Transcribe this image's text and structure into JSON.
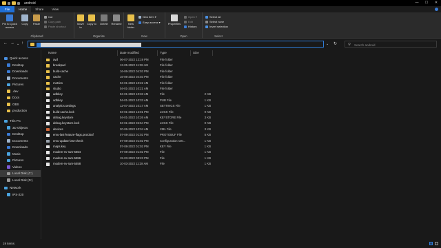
{
  "window": {
    "title": "android",
    "controls": [
      "—",
      "☐",
      "✕"
    ]
  },
  "ribbon_tabs": [
    "File",
    "Home",
    "Share",
    "View"
  ],
  "ribbon": {
    "clipboard": {
      "name": "Clipboard",
      "pin": "Pin to Quick access",
      "copy": "Copy",
      "paste": "Paste",
      "cut": "Cut",
      "copy_path": "Copy path",
      "paste_shortcut": "Paste shortcut"
    },
    "organize": {
      "name": "Organize",
      "move_to": "Move to",
      "copy_to": "Copy to",
      "delete": "Delete",
      "rename": "Rename"
    },
    "new": {
      "name": "New",
      "new_folder": "New folder",
      "new_item": "New item ▾",
      "easy_access": "Easy access ▾"
    },
    "open": {
      "name": "Open",
      "properties": "Properties",
      "open": "Open ▾",
      "edit": "Edit",
      "history": "History"
    },
    "select": {
      "name": "Select",
      "select_all": "Select all",
      "select_none": "Select none",
      "invert": "Invert selection"
    }
  },
  "address": {
    "search_placeholder": "Search android"
  },
  "sidebar": {
    "items": [
      {
        "label": "Quick access",
        "icon": "star-icon",
        "color": "#4a90e2"
      },
      {
        "label": "Desktop",
        "icon": "desktop-icon",
        "color": "#3a7bd5"
      },
      {
        "label": "Downloads",
        "icon": "downloads-icon",
        "color": "#3a7bd5"
      },
      {
        "label": "Documents",
        "icon": "documents-icon",
        "color": "#9fb4cc"
      },
      {
        "label": "Pictures",
        "icon": "pictures-icon",
        "color": "#4aa3df"
      },
      {
        "label": ".dev",
        "icon": "folder-icon",
        "color": "#e8c04a"
      },
      {
        "label": "Docs",
        "icon": "folder-icon",
        "color": "#e8c04a"
      },
      {
        "label": "OBS",
        "icon": "folder-icon",
        "color": "#e8c04a"
      },
      {
        "label": "production",
        "icon": "folder-icon",
        "color": "#e8c04a"
      },
      {
        "label": "This PC",
        "icon": "computer-icon",
        "color": "#4aa3df"
      },
      {
        "label": "3D Objects",
        "icon": "3d-objects-icon",
        "color": "#4aa3df"
      },
      {
        "label": "Desktop",
        "icon": "desktop-icon",
        "color": "#3a7bd5"
      },
      {
        "label": "Documents",
        "icon": "documents-icon",
        "color": "#9fb4cc"
      },
      {
        "label": "Downloads",
        "icon": "downloads-icon",
        "color": "#3a7bd5"
      },
      {
        "label": "Music",
        "icon": "music-icon",
        "color": "#4aa3df"
      },
      {
        "label": "Pictures",
        "icon": "pictures-icon",
        "color": "#4aa3df"
      },
      {
        "label": "Videos",
        "icon": "videos-icon",
        "color": "#7b5ad6"
      },
      {
        "label": "Local Disk (C:)",
        "icon": "drive-icon",
        "color": "#9a9a9a"
      },
      {
        "label": "Local Disk (D:)",
        "icon": "drive-icon",
        "color": "#9a9a9a"
      },
      {
        "label": "Network",
        "icon": "network-icon",
        "color": "#4aa3df"
      },
      {
        "label": "IPS-220",
        "icon": "computer-icon",
        "color": "#4aa3df"
      }
    ]
  },
  "columns": {
    "name": "Name",
    "date": "Date modified",
    "type": "Type",
    "size": "Size"
  },
  "files": [
    {
      "name": "avd",
      "date": "06-07-2022 12:19 PM",
      "type": "File folder",
      "size": "",
      "kind": "folder"
    },
    {
      "name": "breakpad",
      "date": "13-05-2022 11:38 AM",
      "type": "File folder",
      "size": "",
      "kind": "folder"
    },
    {
      "name": "build-cache",
      "date": "16-06-2022 04:03 PM",
      "type": "File folder",
      "size": "",
      "kind": "folder"
    },
    {
      "name": "cache",
      "date": "16-06-2022 04:03 PM",
      "type": "File folder",
      "size": "",
      "kind": "folder"
    },
    {
      "name": "metrics",
      "date": "04-01-2022 10:22 AM",
      "type": "File folder",
      "size": "",
      "kind": "folder"
    },
    {
      "name": "studio",
      "date": "04-01-2022 10:21 AM",
      "type": "File folder",
      "size": "",
      "kind": "folder"
    },
    {
      "name": "adbkey",
      "date": "04-01-2022 10:33 AM",
      "type": "File",
      "size": "2 KB",
      "kind": "file"
    },
    {
      "name": "adbkey",
      "date": "04-01-2022 10:33 AM",
      "type": "PUB File",
      "size": "1 KB",
      "kind": "file"
    },
    {
      "name": "analytics.settings",
      "date": "12-07-2022 10:17 AM",
      "type": "SETTINGS File",
      "size": "1 KB",
      "kind": "file"
    },
    {
      "name": "build-cache.lock",
      "date": "04-01-2022 12:01 PM",
      "type": "LOCK File",
      "size": "0 KB",
      "kind": "file"
    },
    {
      "name": "debug.keystore",
      "date": "04-01-2022 10:26 AM",
      "type": "KEYSTORE File",
      "size": "3 KB",
      "kind": "file"
    },
    {
      "name": "debug.keystore.lock",
      "date": "04-01-2022 02:54 PM",
      "type": "LOCK File",
      "size": "0 KB",
      "kind": "file"
    },
    {
      "name": "devices",
      "date": "20-06-2022 10:34 AM",
      "type": "XML File",
      "size": "3 KB",
      "kind": "xml"
    },
    {
      "name": "emu-last-feature-flags.protobuf",
      "date": "07-08-2022 01:02 PM",
      "type": "PROTOBUF File",
      "size": "5 KB",
      "kind": "file"
    },
    {
      "name": "emu-update-last-check",
      "date": "07-08-2022 01:02 PM",
      "type": "Configuration sett...",
      "size": "1 KB",
      "kind": "config"
    },
    {
      "name": "maps.key",
      "date": "07-08-2022 01:02 PM",
      "type": "KEY File",
      "size": "1 KB",
      "kind": "file"
    },
    {
      "name": "modem-nv-ram-5554",
      "date": "07-08-2022 01:02 PM",
      "type": "File",
      "size": "1 KB",
      "kind": "file"
    },
    {
      "name": "modem-nv-ram-5556",
      "date": "15-03-2022 08:23 PM",
      "type": "File",
      "size": "1 KB",
      "kind": "file"
    },
    {
      "name": "modem-nv-ram-5558",
      "date": "10-03-2022 11:38 AM",
      "type": "File",
      "size": "1 KB",
      "kind": "file"
    }
  ],
  "status": {
    "count": "19 items"
  },
  "colors": {
    "accent": "#1f6fd6",
    "folder": "#e8c04a",
    "background": "#191919"
  }
}
